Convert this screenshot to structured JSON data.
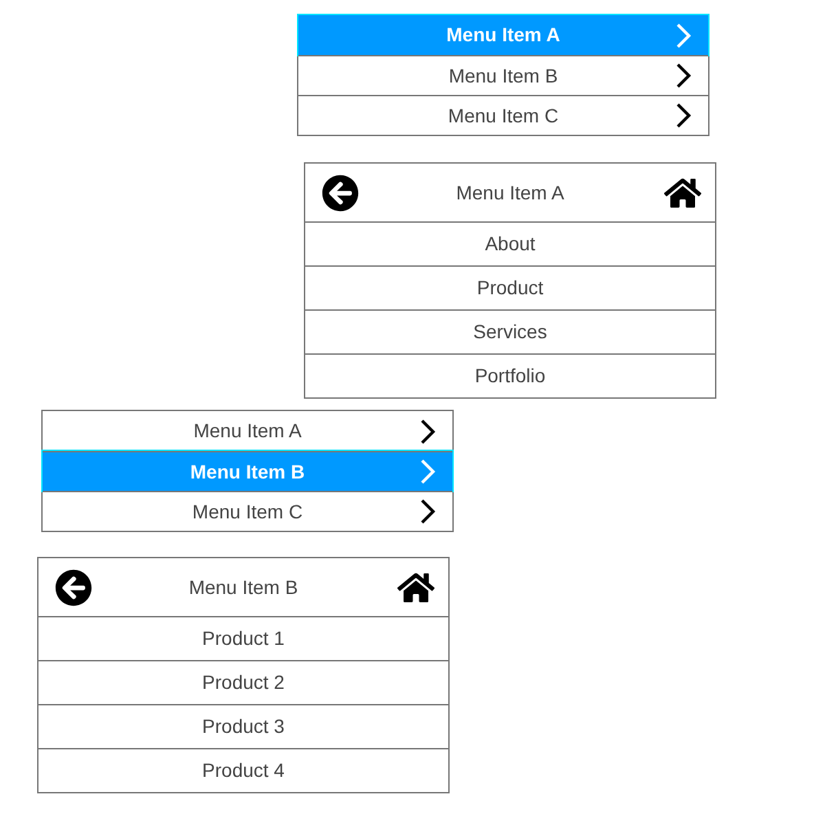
{
  "panels": [
    {
      "kind": "menu",
      "items": [
        {
          "label": "Menu Item A",
          "selected": true
        },
        {
          "label": "Menu Item B",
          "selected": false
        },
        {
          "label": "Menu Item C",
          "selected": false
        }
      ]
    },
    {
      "kind": "submenu",
      "title": "Menu Item A",
      "items": [
        {
          "label": "About"
        },
        {
          "label": "Product"
        },
        {
          "label": "Services"
        },
        {
          "label": "Portfolio"
        }
      ]
    },
    {
      "kind": "menu",
      "items": [
        {
          "label": "Menu Item A",
          "selected": false
        },
        {
          "label": "Menu Item B",
          "selected": true
        },
        {
          "label": "Menu Item C",
          "selected": false
        }
      ]
    },
    {
      "kind": "submenu",
      "title": "Menu Item B",
      "items": [
        {
          "label": "Product 1"
        },
        {
          "label": "Product 2"
        },
        {
          "label": "Product 3"
        },
        {
          "label": "Product 4"
        }
      ]
    }
  ]
}
